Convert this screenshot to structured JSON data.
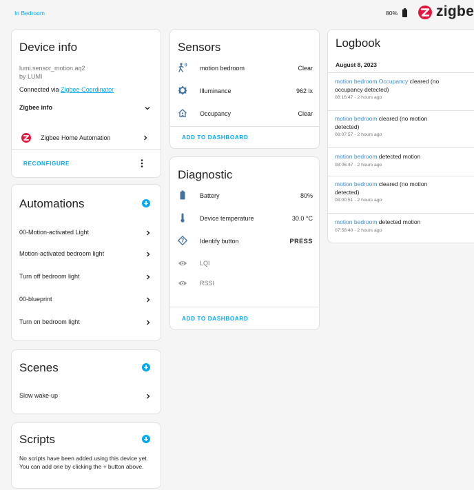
{
  "header": {
    "breadcrumb": "In Bedroom",
    "battery": "80%",
    "brand": "zigbee"
  },
  "device_info": {
    "title": "Device info",
    "model": "lumi.sensor_motion.aq2",
    "manufacturer": "by LUMI",
    "connected_prefix": "Connected via ",
    "connected_link": "Zigbee Coordinator",
    "zigbee_info": "Zigbee info",
    "integration": "Zigbee Home Automation",
    "reconfigure": "RECONFIGURE"
  },
  "automations": {
    "title": "Automations",
    "items": [
      {
        "label": "00-Motion-activated Light"
      },
      {
        "label": "Motion-activated bedroom light"
      },
      {
        "label": "Turn off bedroom light"
      },
      {
        "label": "00-blueprint"
      },
      {
        "label": "Turn on bedroom light"
      }
    ]
  },
  "scenes": {
    "title": "Scenes",
    "items": [
      {
        "label": "Slow wake-up"
      }
    ]
  },
  "scripts": {
    "title": "Scripts",
    "empty_text": "No scripts have been added using this device yet. You can add one by clicking the + button above."
  },
  "sensors": {
    "title": "Sensors",
    "rows": [
      {
        "icon": "motion-sensor-icon",
        "label": "motion bedroom",
        "value": "Clear"
      },
      {
        "icon": "brightness-icon",
        "label": "Illuminance",
        "value": "962 lx"
      },
      {
        "icon": "home-occupancy-icon",
        "label": "Occupancy",
        "value": "Clear"
      }
    ],
    "add_to_dashboard": "ADD TO DASHBOARD"
  },
  "diagnostic": {
    "title": "Diagnostic",
    "rows": [
      {
        "icon": "battery-icon",
        "label": "Battery",
        "value": "80%"
      },
      {
        "icon": "thermometer-icon",
        "label": "Device temperature",
        "value": "30.0 °C"
      },
      {
        "icon": "identify-icon",
        "label": "Identify button",
        "value": "PRESS"
      },
      {
        "icon": "eye-icon",
        "label": "LQI",
        "value": ""
      },
      {
        "icon": "eye-icon",
        "label": "RSSI",
        "value": ""
      }
    ],
    "add_to_dashboard": "ADD TO DASHBOARD"
  },
  "logbook": {
    "title": "Logbook",
    "date": "August 8, 2023",
    "entries": [
      {
        "source": "motion bedroom Occupancy",
        "message": " cleared (no occupancy detected)",
        "time": "08:16:47 - 2 hours ago"
      },
      {
        "source": "motion bedroom",
        "message": " cleared (no motion detected)",
        "time": "08:07:57 - 2 hours ago"
      },
      {
        "source": "motion bedroom",
        "message": " detected motion",
        "time": "08:06:47 - 2 hours ago"
      },
      {
        "source": "motion bedroom",
        "message": " cleared (no motion detected)",
        "time": "08:00:51 - 2 hours ago"
      },
      {
        "source": "motion bedroom",
        "message": " detected motion",
        "time": "07:58:40 - 2 hours ago"
      }
    ]
  },
  "colors": {
    "accent": "#03a9f4",
    "link": "#3f8ed0",
    "zha_logo": "#e3173d",
    "icon": "#44739e"
  }
}
